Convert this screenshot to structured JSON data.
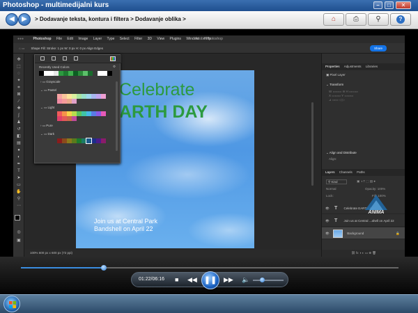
{
  "window": {
    "title": "Photoshop - multimedijalni kurs",
    "minimize_glyph": "–",
    "maximize_glyph": "□",
    "close_glyph": "✕"
  },
  "nav": {
    "back_icon": "left-arrow-icon",
    "forward_icon": "right-arrow-icon",
    "breadcrumb": ">  Dodavanje teksta, kontura i filtera  >  Dodavanje oblika  >",
    "toolbar": [
      {
        "name": "home-icon",
        "glyph": "⌂"
      },
      {
        "name": "print-icon",
        "glyph": "⎙"
      },
      {
        "name": "search-icon",
        "glyph": "⚲"
      },
      {
        "name": "help-icon",
        "glyph": "?"
      }
    ]
  },
  "photoshop": {
    "app_name": "Photoshop",
    "menu": [
      "File",
      "Edit",
      "Image",
      "Layer",
      "Type",
      "Select",
      "Filter",
      "3D",
      "View",
      "Plugins",
      "Window",
      "Help"
    ],
    "document_title": "Adobe Photoshop",
    "options_bar": "Shape   Fill:   Stroke:   1 px   W: 0 px   H: 0 px   Align Edges",
    "share_label": "Share",
    "status": "100%    600 px x 600 px (72 ppi)",
    "canvas": {
      "headline_line1": "Celebrate",
      "headline_line2": "ARTH DAY",
      "invite_line1": "Join us at Central Park",
      "invite_line2": "Bandshell on April 22"
    },
    "swatches_popup": {
      "header": "Recently Used Colors",
      "folders": [
        "Grayscale",
        "Pastel",
        "Light",
        "Pure",
        "Dark"
      ]
    },
    "properties_panel": {
      "tabs": [
        "Properties",
        "Adjustments",
        "Libraries"
      ],
      "pixel_layer": "Pixel Layer",
      "transform": "Transform",
      "align": "Align and Distribute",
      "align_sub": "Align:"
    },
    "layers_panel": {
      "tabs": [
        "Layers",
        "Channels",
        "Paths"
      ],
      "kind_filter": "Kind",
      "blend_mode": "Normal",
      "opacity": "Opacity: 100%",
      "lock": "Lock:",
      "fill": "Fill: 100%",
      "layers": [
        {
          "name": "Celebrate EARTH DAY",
          "type": "text"
        },
        {
          "name": "Join us at Central ...ahell on April 22",
          "type": "text"
        },
        {
          "name": "Background",
          "type": "image",
          "selected": true
        }
      ]
    }
  },
  "watermark": {
    "text": "ANIMA"
  },
  "player": {
    "timecode": "01:22/06:16",
    "progress": 0.22,
    "volume": 0.3,
    "stop_icon": "stop-icon",
    "rewind_icon": "rewind-icon",
    "pause_icon": "pause-icon",
    "forward_icon": "fast-forward-icon",
    "volume_icon": "volume-icon"
  },
  "taskbar": {
    "start_icon": "windows-start-icon"
  },
  "colors": {
    "title_bar": "#2a5c9e",
    "canvas_sky": "#4f98e4",
    "headline_green": "#2c9a3f",
    "player_accent": "#1b63c4"
  }
}
